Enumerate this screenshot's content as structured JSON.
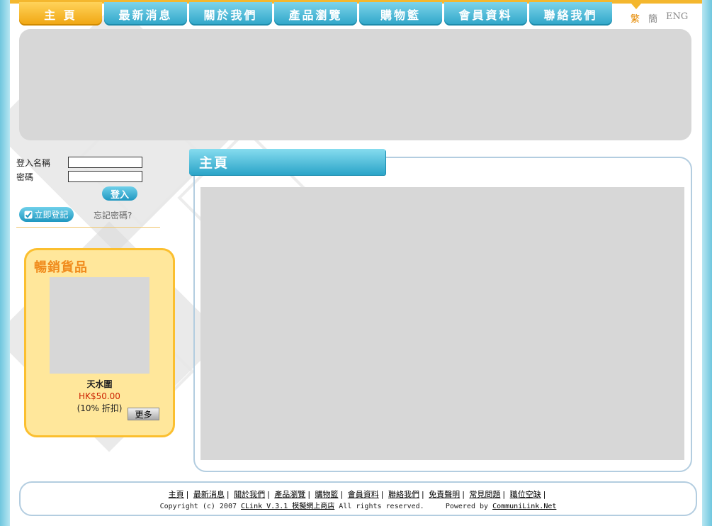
{
  "nav": {
    "tabs": [
      {
        "label": "主 頁",
        "active": true
      },
      {
        "label": "最新消息",
        "active": false
      },
      {
        "label": "關於我們",
        "active": false
      },
      {
        "label": "產品瀏覽",
        "active": false
      },
      {
        "label": "購物籃",
        "active": false
      },
      {
        "label": "會員資料",
        "active": false
      },
      {
        "label": "聯絡我們",
        "active": false
      }
    ]
  },
  "lang": {
    "trad": "繁",
    "simp": "簡",
    "eng": "ENG"
  },
  "login": {
    "username_label": "登入名稱",
    "password_label": "密碼",
    "username_value": "",
    "password_value": "",
    "login_button": "登入",
    "register_button": "立即登記",
    "forgot": "忘記密碼?"
  },
  "bestseller": {
    "title": "暢銷貨品",
    "product_name": "天水圍",
    "price": "HK$50.00",
    "discount": "(10% 折扣)",
    "more_button": "更多"
  },
  "main": {
    "title": "主頁"
  },
  "footer": {
    "links": [
      "主頁",
      "最新消息",
      "關於我們",
      "產品瀏覽",
      "購物籃",
      "會員資料",
      "聯絡我們",
      "免責聲明",
      "常見問題",
      "職位空缺"
    ],
    "separator": "|",
    "copyright_prefix": "Copyright (c) 2007",
    "copyright_link": "CLink V.3.1 模擬網上商店",
    "rights": "All rights reserved.",
    "powered_prefix": "Powered by",
    "powered_link": "CommuniLink.Net"
  },
  "colors": {
    "accent": "#f4b72e",
    "tab": "#2da5c8",
    "price": "#cc2200"
  }
}
